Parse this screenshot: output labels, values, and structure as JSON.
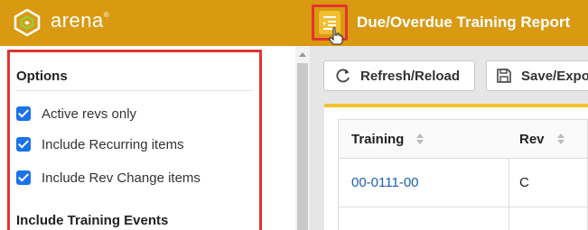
{
  "header": {
    "brand": "arena",
    "brand_mark": "®",
    "title": "Due/Overdue Training Report",
    "bg_color": "#d99a12",
    "menu_icon": "menu-collapse-icon"
  },
  "options": {
    "heading": "Options",
    "checkboxes": [
      {
        "label": "Active revs only",
        "checked": true
      },
      {
        "label": "Include Recurring items",
        "checked": true
      },
      {
        "label": "Include Rev Change items",
        "checked": true
      }
    ],
    "subheading": "Include Training Events"
  },
  "toolbar": {
    "refresh_label": "Refresh/Reload",
    "save_label": "Save/Expo"
  },
  "table": {
    "columns": [
      "Training",
      "Rev"
    ],
    "rows": [
      {
        "training": "00-0111-00",
        "rev": "C"
      }
    ]
  },
  "colors": {
    "accent": "#d99a12",
    "highlight": "#e3342f",
    "checkbox": "#1a73e8",
    "link": "#1f5fb0"
  }
}
